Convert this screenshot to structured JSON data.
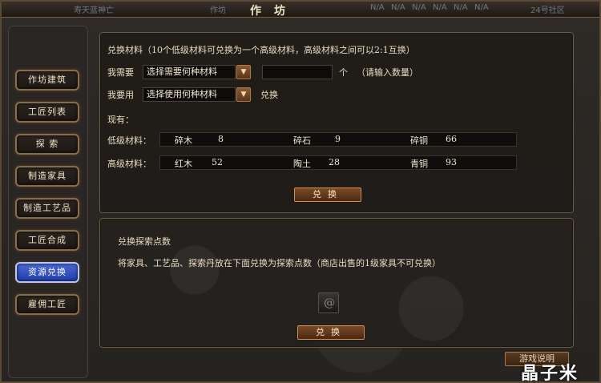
{
  "titlebar": {
    "bg_left": "寿天蓝神亡",
    "bg_mid": "作坊",
    "title": "作坊",
    "bg_na": [
      "N/A",
      "N/A",
      "N/A",
      "N/A",
      "N/A",
      "N/A"
    ],
    "bg_right": "24号社区"
  },
  "sidebar": {
    "items": [
      {
        "label": "作坊建筑"
      },
      {
        "label": "工匠列表"
      },
      {
        "label": "探 索"
      },
      {
        "label": "制造家具"
      },
      {
        "label": "制造工艺品"
      },
      {
        "label": "工匠合成"
      },
      {
        "label": "资源兑换",
        "active": true
      },
      {
        "label": "雇佣工匠"
      }
    ]
  },
  "exchange": {
    "header": "兑换材料（10个低级材料可兑换为一个高级材料，高级材料之间可以2:1互换）",
    "need_label": "我需要",
    "need_select": "选择需要何种材料",
    "qty_value": "",
    "qty_unit": "个",
    "qty_hint": "（请输入数量）",
    "use_label": "我要用",
    "use_select": "选择使用何种材料",
    "use_suffix": "兑换",
    "have_label": "现有：",
    "low_label": "低级材料：",
    "high_label": "高级材料：",
    "low_materials": [
      {
        "name": "碎木",
        "count": "8"
      },
      {
        "name": "碎石",
        "count": "9"
      },
      {
        "name": "碎铜",
        "count": "66"
      }
    ],
    "high_materials": [
      {
        "name": "红木",
        "count": "52"
      },
      {
        "name": "陶土",
        "count": "28"
      },
      {
        "name": "青铜",
        "count": "93"
      }
    ],
    "button": "兑换"
  },
  "explore": {
    "header": "兑换探索点数",
    "desc": "将家具、工艺品、探索丹放在下面兑换为探索点数（商店出售的1级家具不可兑换）",
    "button": "兑换"
  },
  "bottom_button": "游戏说明",
  "watermark": "晶子米",
  "colors": {
    "active_tab": "#2f4fc0",
    "button_bg": "#6a3c1e",
    "border_gold": "#8a6e4c"
  }
}
